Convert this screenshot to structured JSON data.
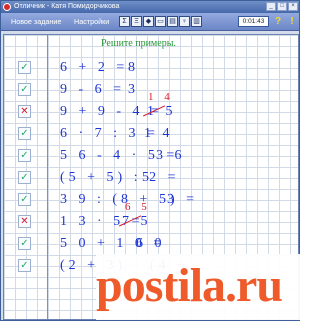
{
  "window": {
    "title": "Отличник - Катя Помидорчикова"
  },
  "toolbar": {
    "new_task": "Новое задание",
    "settings": "Настройки",
    "icons": [
      "Σ",
      "Ξ",
      "◆",
      "▭",
      "▤",
      "♀",
      "▥"
    ],
    "timer": "0:01:43",
    "help": "?",
    "exit": "!"
  },
  "page": {
    "heading": "Решите примеры."
  },
  "examples": [
    {
      "expr": "6 + 2 =",
      "answer": "8",
      "status": "correct",
      "correction": ""
    },
    {
      "expr": "9 - 6 =",
      "answer": "3",
      "status": "correct",
      "correction": ""
    },
    {
      "expr": "9 + 9 - 4 =",
      "answer": "1 5",
      "status": "wrong",
      "correction": "1 4"
    },
    {
      "expr": "6 · 7 : 3 =",
      "answer": "1 4",
      "status": "correct",
      "correction": ""
    },
    {
      "expr": "5 6 - 4 · 5 =",
      "answer": "3 6",
      "status": "correct",
      "correction": ""
    },
    {
      "expr": "(5 + 5) : 2 =",
      "answer": "5",
      "status": "correct",
      "correction": ""
    },
    {
      "expr": "3 9 : (8 + 5) =",
      "answer": "3",
      "status": "correct",
      "correction": ""
    },
    {
      "expr": "1 3 · 5 =",
      "answer": "7 5",
      "status": "wrong",
      "correction": "6 5"
    },
    {
      "expr": "5 0 + 1 0 =",
      "answer": "6 0",
      "status": "correct",
      "correction": ""
    },
    {
      "expr": "(2 + 3) · (4 +",
      "answer": "",
      "status": "correct",
      "correction": ""
    }
  ],
  "watermark": "postila.ru"
}
